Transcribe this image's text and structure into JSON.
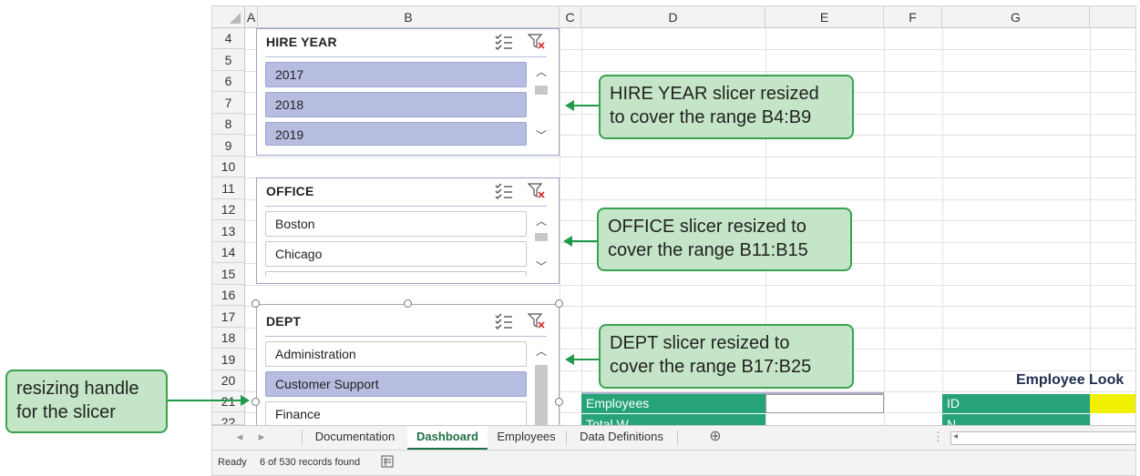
{
  "columns": [
    "A",
    "B",
    "C",
    "D",
    "E",
    "F",
    "G"
  ],
  "rows": [
    "4",
    "5",
    "6",
    "7",
    "8",
    "9",
    "10",
    "11",
    "12",
    "13",
    "14",
    "15",
    "16",
    "17",
    "18",
    "19",
    "20",
    "21",
    "22"
  ],
  "slicers": {
    "hire_year": {
      "title": "HIRE YEAR",
      "items": [
        "2017",
        "2018",
        "2019"
      ]
    },
    "office": {
      "title": "OFFICE",
      "items": [
        "Boston",
        "Chicago"
      ]
    },
    "dept": {
      "title": "DEPT",
      "items": [
        "Administration",
        "Customer Support",
        "Finance"
      ]
    }
  },
  "sheet_cells": {
    "employee_lookup_title": "Employee Look",
    "employees_label": "Employees",
    "total_label": "Total W",
    "id_label": "ID",
    "n_label": "N"
  },
  "tabs": [
    "Documentation",
    "Dashboard",
    "Employees",
    "Data Definitions"
  ],
  "active_tab": "Dashboard",
  "status": {
    "ready": "Ready",
    "records": "6 of 530 records found"
  },
  "callouts": {
    "hire_year": [
      "HIRE YEAR slicer resized",
      "to cover the range B4:B9"
    ],
    "office": [
      "OFFICE slicer resized to",
      "cover the range B11:B15"
    ],
    "dept": [
      "DEPT slicer resized to",
      "cover the range B17:B25"
    ],
    "handle": [
      "resizing handle",
      "for the slicer"
    ]
  },
  "colors": {
    "accent_green": "#27a37a",
    "slicer_selected": "#b7bde0",
    "callout_fill": "#c4e5c7",
    "callout_border": "#3aa24f",
    "tab_active": "#1e7145",
    "yellow_cell": "#f1f000"
  }
}
